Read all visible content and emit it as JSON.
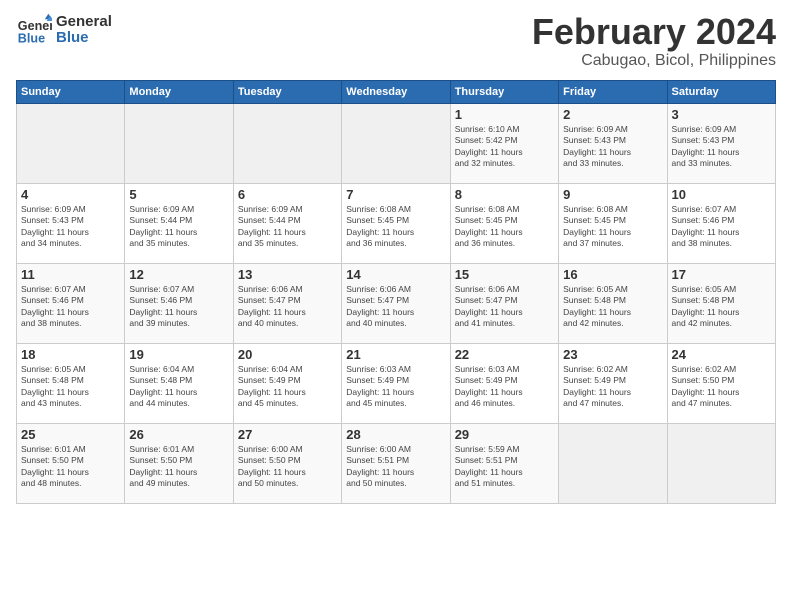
{
  "logo": {
    "line1": "General",
    "line2": "Blue"
  },
  "title": "February 2024",
  "subtitle": "Cabugao, Bicol, Philippines",
  "days_of_week": [
    "Sunday",
    "Monday",
    "Tuesday",
    "Wednesday",
    "Thursday",
    "Friday",
    "Saturday"
  ],
  "weeks": [
    [
      {
        "day": "",
        "info": ""
      },
      {
        "day": "",
        "info": ""
      },
      {
        "day": "",
        "info": ""
      },
      {
        "day": "",
        "info": ""
      },
      {
        "day": "1",
        "info": "Sunrise: 6:10 AM\nSunset: 5:42 PM\nDaylight: 11 hours\nand 32 minutes."
      },
      {
        "day": "2",
        "info": "Sunrise: 6:09 AM\nSunset: 5:43 PM\nDaylight: 11 hours\nand 33 minutes."
      },
      {
        "day": "3",
        "info": "Sunrise: 6:09 AM\nSunset: 5:43 PM\nDaylight: 11 hours\nand 33 minutes."
      }
    ],
    [
      {
        "day": "4",
        "info": "Sunrise: 6:09 AM\nSunset: 5:43 PM\nDaylight: 11 hours\nand 34 minutes."
      },
      {
        "day": "5",
        "info": "Sunrise: 6:09 AM\nSunset: 5:44 PM\nDaylight: 11 hours\nand 35 minutes."
      },
      {
        "day": "6",
        "info": "Sunrise: 6:09 AM\nSunset: 5:44 PM\nDaylight: 11 hours\nand 35 minutes."
      },
      {
        "day": "7",
        "info": "Sunrise: 6:08 AM\nSunset: 5:45 PM\nDaylight: 11 hours\nand 36 minutes."
      },
      {
        "day": "8",
        "info": "Sunrise: 6:08 AM\nSunset: 5:45 PM\nDaylight: 11 hours\nand 36 minutes."
      },
      {
        "day": "9",
        "info": "Sunrise: 6:08 AM\nSunset: 5:45 PM\nDaylight: 11 hours\nand 37 minutes."
      },
      {
        "day": "10",
        "info": "Sunrise: 6:07 AM\nSunset: 5:46 PM\nDaylight: 11 hours\nand 38 minutes."
      }
    ],
    [
      {
        "day": "11",
        "info": "Sunrise: 6:07 AM\nSunset: 5:46 PM\nDaylight: 11 hours\nand 38 minutes."
      },
      {
        "day": "12",
        "info": "Sunrise: 6:07 AM\nSunset: 5:46 PM\nDaylight: 11 hours\nand 39 minutes."
      },
      {
        "day": "13",
        "info": "Sunrise: 6:06 AM\nSunset: 5:47 PM\nDaylight: 11 hours\nand 40 minutes."
      },
      {
        "day": "14",
        "info": "Sunrise: 6:06 AM\nSunset: 5:47 PM\nDaylight: 11 hours\nand 40 minutes."
      },
      {
        "day": "15",
        "info": "Sunrise: 6:06 AM\nSunset: 5:47 PM\nDaylight: 11 hours\nand 41 minutes."
      },
      {
        "day": "16",
        "info": "Sunrise: 6:05 AM\nSunset: 5:48 PM\nDaylight: 11 hours\nand 42 minutes."
      },
      {
        "day": "17",
        "info": "Sunrise: 6:05 AM\nSunset: 5:48 PM\nDaylight: 11 hours\nand 42 minutes."
      }
    ],
    [
      {
        "day": "18",
        "info": "Sunrise: 6:05 AM\nSunset: 5:48 PM\nDaylight: 11 hours\nand 43 minutes."
      },
      {
        "day": "19",
        "info": "Sunrise: 6:04 AM\nSunset: 5:48 PM\nDaylight: 11 hours\nand 44 minutes."
      },
      {
        "day": "20",
        "info": "Sunrise: 6:04 AM\nSunset: 5:49 PM\nDaylight: 11 hours\nand 45 minutes."
      },
      {
        "day": "21",
        "info": "Sunrise: 6:03 AM\nSunset: 5:49 PM\nDaylight: 11 hours\nand 45 minutes."
      },
      {
        "day": "22",
        "info": "Sunrise: 6:03 AM\nSunset: 5:49 PM\nDaylight: 11 hours\nand 46 minutes."
      },
      {
        "day": "23",
        "info": "Sunrise: 6:02 AM\nSunset: 5:49 PM\nDaylight: 11 hours\nand 47 minutes."
      },
      {
        "day": "24",
        "info": "Sunrise: 6:02 AM\nSunset: 5:50 PM\nDaylight: 11 hours\nand 47 minutes."
      }
    ],
    [
      {
        "day": "25",
        "info": "Sunrise: 6:01 AM\nSunset: 5:50 PM\nDaylight: 11 hours\nand 48 minutes."
      },
      {
        "day": "26",
        "info": "Sunrise: 6:01 AM\nSunset: 5:50 PM\nDaylight: 11 hours\nand 49 minutes."
      },
      {
        "day": "27",
        "info": "Sunrise: 6:00 AM\nSunset: 5:50 PM\nDaylight: 11 hours\nand 50 minutes."
      },
      {
        "day": "28",
        "info": "Sunrise: 6:00 AM\nSunset: 5:51 PM\nDaylight: 11 hours\nand 50 minutes."
      },
      {
        "day": "29",
        "info": "Sunrise: 5:59 AM\nSunset: 5:51 PM\nDaylight: 11 hours\nand 51 minutes."
      },
      {
        "day": "",
        "info": ""
      },
      {
        "day": "",
        "info": ""
      }
    ]
  ]
}
